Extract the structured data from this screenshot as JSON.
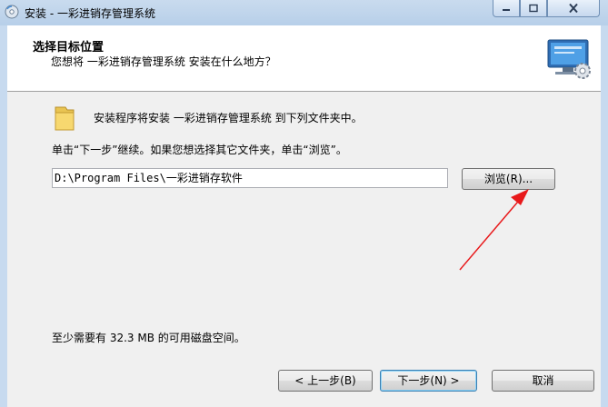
{
  "window": {
    "title": "安装 - 一彩进销存管理系统"
  },
  "icons": {
    "app": "setup-disc-icon",
    "header": "computer-gear-icon",
    "folder": "folder-icon",
    "minimize": "minimize-icon",
    "maximize": "maximize-icon",
    "close": "close-icon"
  },
  "header": {
    "title": "选择目标位置",
    "subtitle": "您想将 一彩进销存管理系统 安装在什么地方？"
  },
  "body": {
    "intro": "安装程序将安装 一彩进销存管理系统 到下列文件夹中。",
    "instruction": "单击“下一步”继续。如果您想选择其它文件夹，单击“浏览”。",
    "path_value": "D:\\Program Files\\一彩进销存软件",
    "browse_label": "浏览(R)...",
    "disk_space": "至少需要有 32.3 MB 的可用磁盘空间。"
  },
  "footer": {
    "back_label": "< 上一步(B)",
    "next_label": "下一步(N) >",
    "cancel_label": "取消"
  },
  "colors": {
    "annotation_arrow": "#e8191b"
  }
}
